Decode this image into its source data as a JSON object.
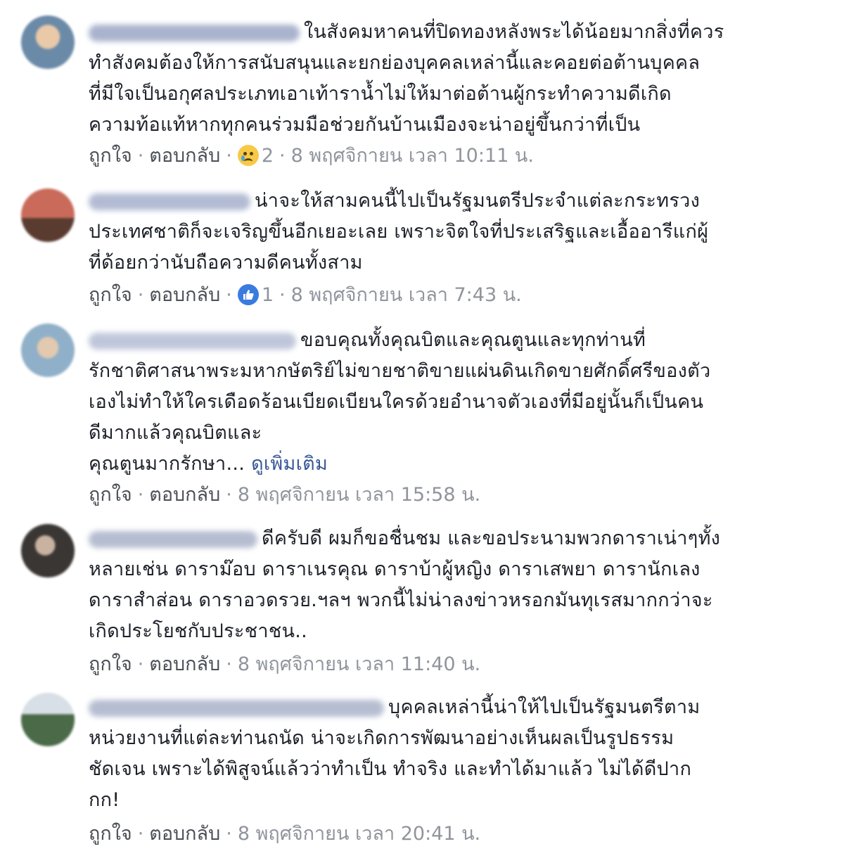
{
  "comments": [
    {
      "author": "Nobdose Intapunya",
      "avatar_color": "#6b8aa8",
      "text_lines": [
        "ในสังคมหาคนที่ปิดทองหลังพระได้น้อยมากสิ่งที่ควร",
        "ทำสังคมต้องให้การสนับสนุนและยกย่องบุคคลเหล่านี้และคอยต่อต้านบุคคล",
        "ที่มีใจเป็นอกุศลประเภทเอาเท้าราน้ำไม่ให้มาต่อต้านผู้กระทำความดีเกิด",
        "ความท้อแท้หากทุกคนร่วมมือช่วยกันบ้านเมืองจะน่าอยู่ขึ้นกว่าที่เป็น"
      ],
      "like_label": "ถูกใจ",
      "reply_label": "ตอบกลับ",
      "reaction": "sad-icon",
      "reaction_count": "2",
      "timestamp": "8 พฤศจิกายน เวลา 10:11 น."
    },
    {
      "author": "Nittaya Kanathi",
      "avatar_color": "#b85a4a",
      "text_lines": [
        "น่าจะให้สามคนนี้ไปเป็นรัฐมนตรีประจำแต่ละกระทรวง",
        "ประเทศชาติก็จะเจริญขึ้นอีกเยอะเลย เพราะจิตใจที่ประเสริฐและเอื้ออารีแก่ผู้",
        "ที่ด้อยกว่านับถือความดีคนทั้งสาม"
      ],
      "like_label": "ถูกใจ",
      "reply_label": "ตอบกลับ",
      "reaction": "like-icon",
      "reaction_count": "1",
      "timestamp": "8 พฤศจิกายน เวลา 7:43 น."
    },
    {
      "author": "Sukho Saisaiparong",
      "avatar_color": "#8fb0c8",
      "text_lines": [
        "ขอบคุณทั้งคุณบิตและคุณตูนและทุกท่านที่",
        "รักชาติศาสนาพระมหากษัตริย์ไม่ขายชาติขายแผ่นดินเกิดขายศักดิ์ศรีของตัว",
        "เองไม่ทำให้ใครเดือดร้อนเบียดเบียนใครด้วยอำนาจตัวเองที่มีอยู่นั้นก็เป็นคน",
        "ดีมากแล้วคุณบิตและ",
        "คุณตูนมากรักษา..."
      ],
      "see_more": "ดูเพิ่มเติม",
      "like_label": "ถูกใจ",
      "reply_label": "ตอบกลับ",
      "timestamp": "8 พฤศจิกายน เวลา 15:58 น."
    },
    {
      "author": "Boss Narrowl",
      "avatar_color": "#3a3634",
      "text_lines": [
        "ดีครับดี ผมก็ขอชื่นชม และขอประนามพวกดาราเน่าๆทั้ง",
        "หลายเช่น ดาราม๊อบ ดาราเนรคุณ ดาราบ้าผู้หญิง ดาราเสพยา ดารานักเลง",
        "ดาราสำส่อน ดาราอวดรวย.ฯลฯ พวกนี้ไม่น่าลงข่าวหรอกมันทุเรสมากกว่าจะ",
        "เกิดประโยชกับประชาชน.."
      ],
      "like_label": "ถูกใจ",
      "reply_label": "ตอบกลับ",
      "timestamp": "8 พฤศจิกายน เวลา 11:40 น."
    },
    {
      "author": "Zeecar Siam Thammachart",
      "avatar_color": "#4a6a48",
      "text_lines": [
        "บุคคลเหล่านี้น่าให้ไปเป็นรัฐมนตรีตาม",
        "หน่วยงานที่แต่ละท่านถนัด น่าจะเกิดการพัฒนาอย่างเห็นผลเป็นรูปธรรม",
        "ชัดเจน เพราะได้พิสูจน์แล้วว่าทำเป็น ทำจริง และทำได้มาแล้ว ไม่ได้ดีปาก",
        "กก!"
      ],
      "like_label": "ถูกใจ",
      "reply_label": "ตอบกลับ",
      "timestamp": "8 พฤศจิกายน เวลา 20:41 น."
    }
  ]
}
